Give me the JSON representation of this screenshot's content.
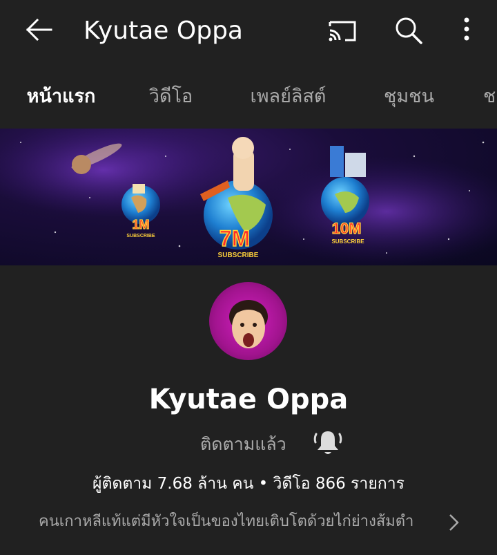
{
  "header": {
    "title": "Kyutae Oppa",
    "icons": [
      "back-arrow-icon",
      "cast-icon",
      "search-icon",
      "more-vert-icon"
    ]
  },
  "tabs": [
    {
      "label": "หน้าแรก",
      "active": true
    },
    {
      "label": "วิดีโอ",
      "active": false
    },
    {
      "label": "เพลย์ลิสต์",
      "active": false
    },
    {
      "label": "ชุมชน",
      "active": false
    },
    {
      "label": "ช",
      "active": false
    }
  ],
  "banner": {
    "milestones": [
      "1M",
      "7M",
      "10M"
    ],
    "subtext": "SUBSCRIBE"
  },
  "channel": {
    "name": "Kyutae Oppa",
    "subscribe_status": "ติดตามแล้ว",
    "stats": "ผู้ติดตาม 7.68 ล้าน คน • วิดีโอ 866 รายการ",
    "description": "คนเกาหลีแท้แต่มีหัวใจเป็นของไทยเติบโตด้วยไก่ย่างส้มตำ"
  },
  "colors": {
    "background": "#212121",
    "text_primary": "#ffffff",
    "text_secondary": "#aaaaaa",
    "avatar_ring": "#c21bb0"
  }
}
